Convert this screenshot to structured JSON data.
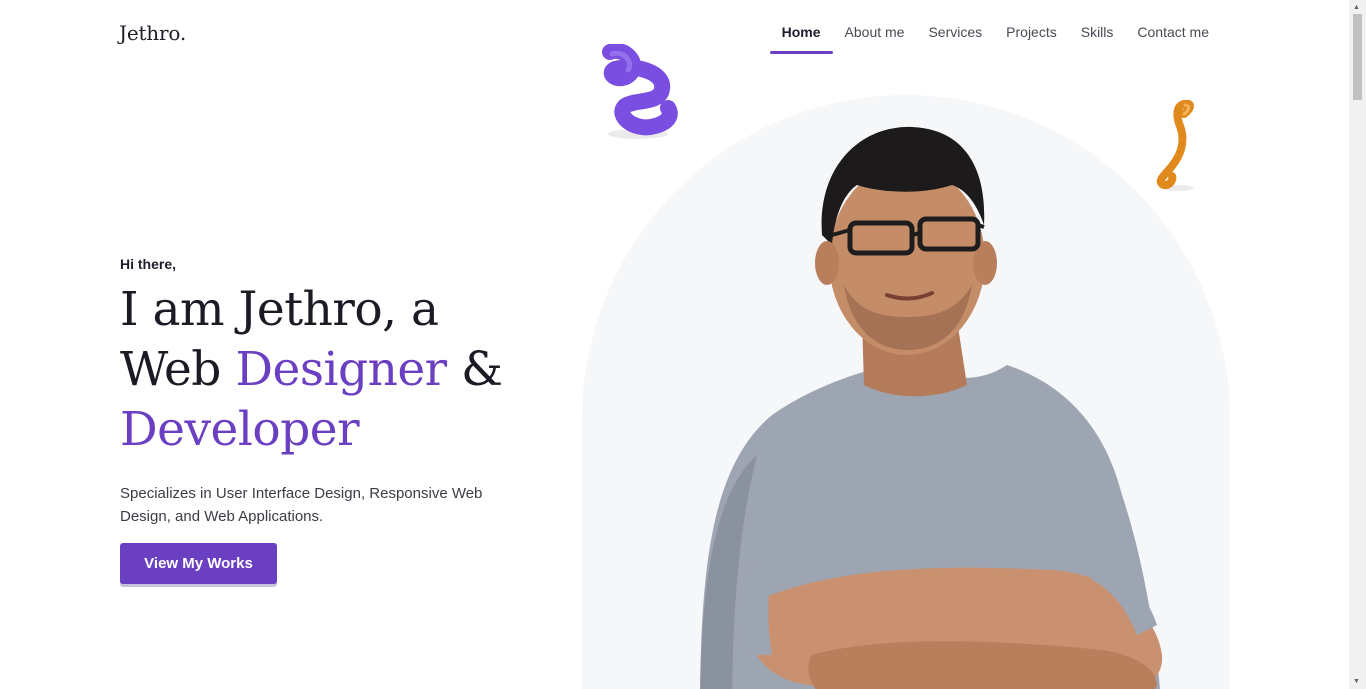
{
  "brand": {
    "logo": "Jethro."
  },
  "nav": {
    "items": [
      {
        "label": "Home",
        "active": true
      },
      {
        "label": "About me",
        "active": false
      },
      {
        "label": "Services",
        "active": false
      },
      {
        "label": "Projects",
        "active": false
      },
      {
        "label": "Skills",
        "active": false
      },
      {
        "label": "Contact me",
        "active": false
      }
    ]
  },
  "hero": {
    "greeting": "Hi there,",
    "headline_line1": "I am Jethro, a",
    "headline_web": "Web ",
    "headline_designer": "Designer",
    "headline_amp": " &",
    "headline_developer": "Developer",
    "subtitle": "Specializes in User Interface Design, Responsive Web Design, and Web Applications.",
    "cta_label": "View My Works"
  },
  "colors": {
    "accent": "#6b3fc2",
    "text": "#1b1b26",
    "arch_bg": "#f6f7f9",
    "deco_purple": "#7a4ee0",
    "deco_orange": "#e08a1e"
  },
  "scrollbar": {
    "up": "▲",
    "down": "▼"
  }
}
